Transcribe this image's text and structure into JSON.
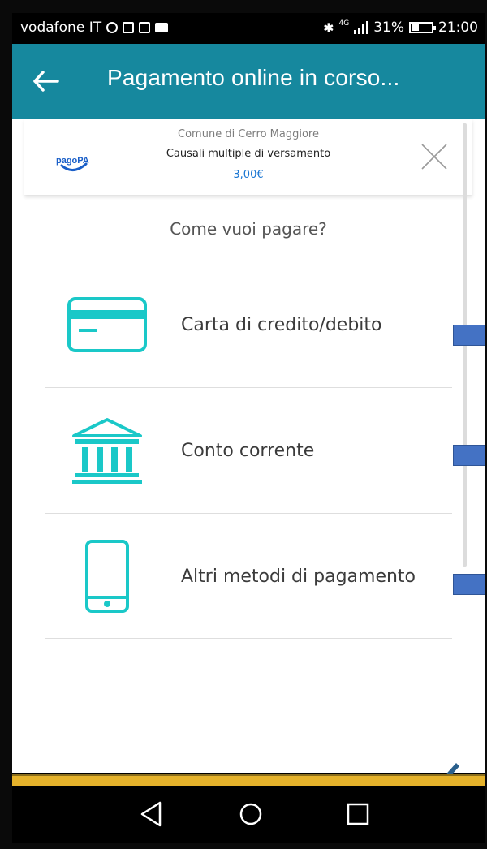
{
  "status_bar": {
    "carrier": "vodafone IT",
    "network": "4G",
    "battery": "31%",
    "time": "21:00"
  },
  "app_bar": {
    "title": "Pagamento online in corso..."
  },
  "header": {
    "logo_text": "pagoPA",
    "entity": "Comune di Cerro Maggiore",
    "reason": "Causali multiple di versamento",
    "amount": "3,00€"
  },
  "question": "Come vuoi pagare?",
  "methods": [
    {
      "label": "Carta di credito/debito",
      "icon": "credit-card-icon"
    },
    {
      "label": "Conto corrente",
      "icon": "bank-icon"
    },
    {
      "label": "Altri metodi di pagamento",
      "icon": "smartphone-icon"
    }
  ],
  "colors": {
    "app_bar": "#16889e",
    "icon_teal": "#1ac8c8",
    "amount_blue": "#1a76d2",
    "marker_blue": "#4472c4",
    "bottom_strip": "#e5b22b"
  }
}
